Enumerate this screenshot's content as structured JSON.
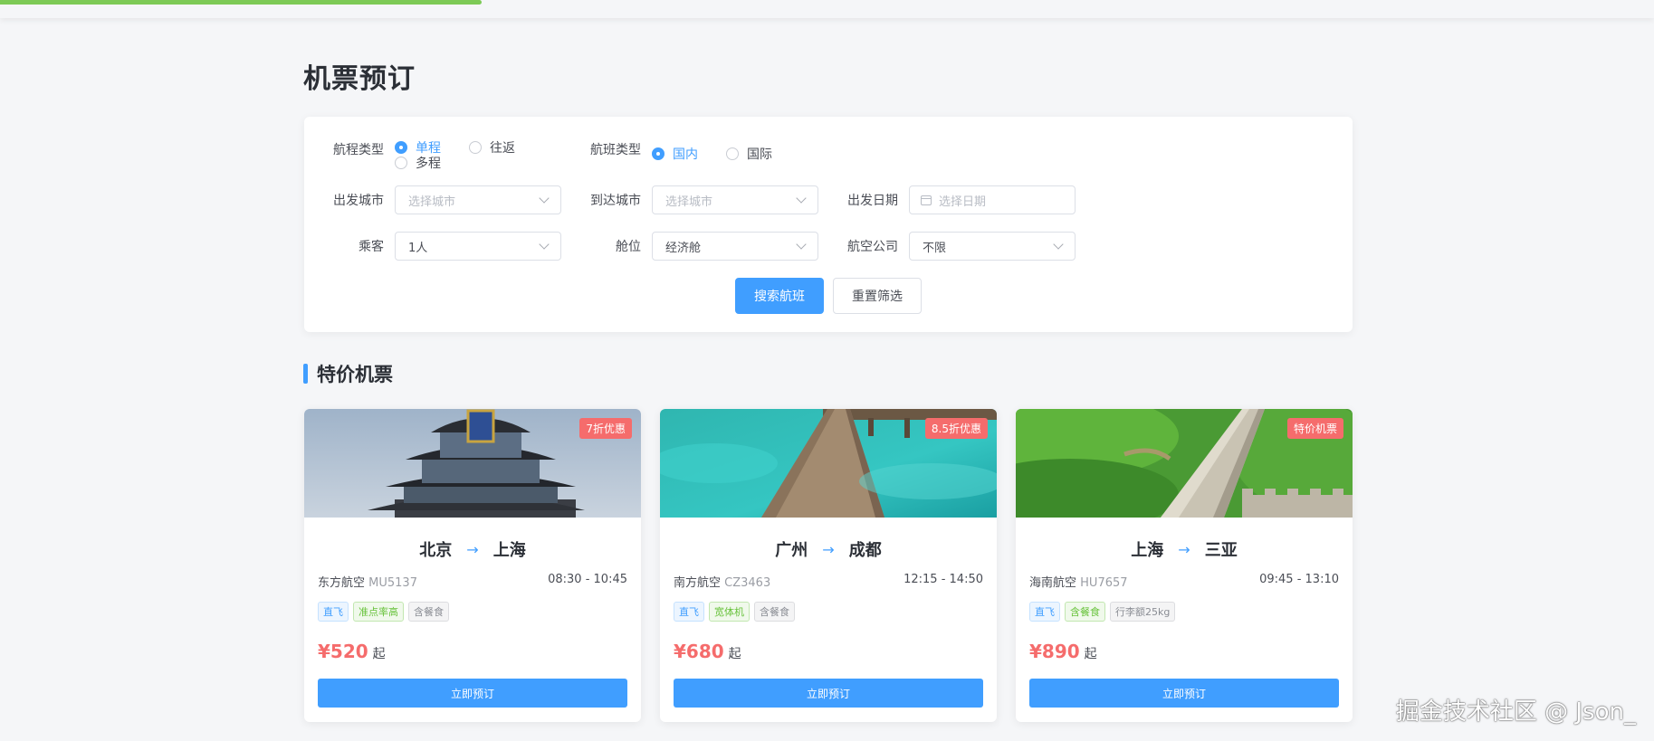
{
  "page": {
    "title": "机票预订"
  },
  "search": {
    "trip_type": {
      "label": "航程类型",
      "options": [
        "单程",
        "往返",
        "多程"
      ],
      "selected": "单程"
    },
    "flight_type": {
      "label": "航班类型",
      "options": [
        "国内",
        "国际"
      ],
      "selected": "国内"
    },
    "depart_city": {
      "label": "出发城市",
      "placeholder": "选择城市"
    },
    "arrive_city": {
      "label": "到达城市",
      "placeholder": "选择城市"
    },
    "depart_date": {
      "label": "出发日期",
      "placeholder": "选择日期"
    },
    "passengers": {
      "label": "乘客",
      "value": "1人"
    },
    "cabin": {
      "label": "舱位",
      "value": "经济舱"
    },
    "airline": {
      "label": "航空公司",
      "value": "不限"
    },
    "search_button": "搜索航班",
    "reset_button": "重置筛选"
  },
  "specials": {
    "title": "特价机票",
    "cards": [
      {
        "badge": "7折优惠",
        "from": "北京",
        "to": "上海",
        "arrow": "→",
        "airline": "东方航空",
        "flight_no": "MU5137",
        "time": "08:30 - 10:45",
        "tags": [
          "直飞",
          "准点率高",
          "含餐食"
        ],
        "price": "¥520",
        "price_suffix": "起",
        "book": "立即预订"
      },
      {
        "badge": "8.5折优惠",
        "from": "广州",
        "to": "成都",
        "arrow": "→",
        "airline": "南方航空",
        "flight_no": "CZ3463",
        "time": "12:15 - 14:50",
        "tags": [
          "直飞",
          "宽体机",
          "含餐食"
        ],
        "price": "¥680",
        "price_suffix": "起",
        "book": "立即预订"
      },
      {
        "badge": "特价机票",
        "from": "上海",
        "to": "三亚",
        "arrow": "→",
        "airline": "海南航空",
        "flight_no": "HU7657",
        "time": "09:45 - 13:10",
        "tags": [
          "直飞",
          "含餐食",
          "行李额25kg"
        ],
        "price": "¥890",
        "price_suffix": "起",
        "book": "立即预订"
      }
    ]
  },
  "watermark": "掘金技术社区 @ Json_",
  "colors": {
    "primary": "#409eff",
    "danger": "#f56c6c",
    "success": "#67c23a"
  }
}
